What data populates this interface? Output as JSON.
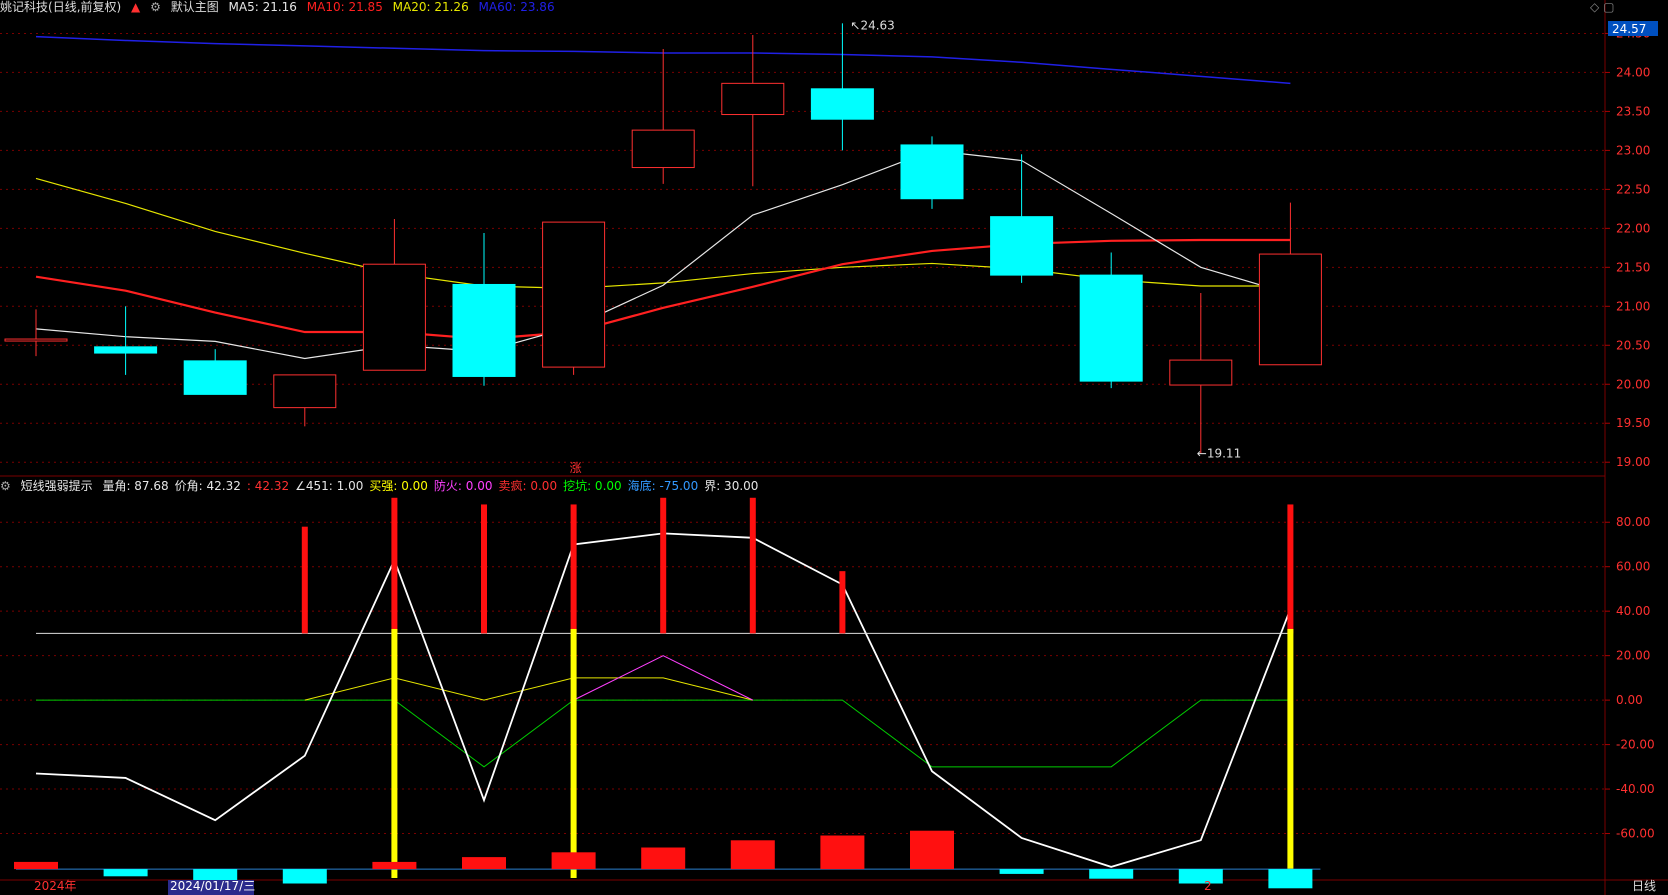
{
  "header": {
    "stock_name": "姚记科技",
    "mode": "(日线,前复权)",
    "template": "默认主图",
    "ma5": "MA5: 21.16",
    "ma10": "MA10: 21.85",
    "ma20": "MA20: 21.26",
    "ma60": "MA60: 23.86"
  },
  "price_axis": {
    "current_price_tag": "24.57",
    "ticks": [
      "24.50",
      "24.00",
      "23.50",
      "23.00",
      "22.50",
      "22.00",
      "21.50",
      "21.00",
      "20.50",
      "20.00",
      "19.50",
      "19.00"
    ]
  },
  "annotations": {
    "high_label": "24.63",
    "low_label": "19.11",
    "rise_marker": "涨"
  },
  "indicator": {
    "name": "短线强弱提示",
    "items": [
      {
        "text": "量角: 87.68",
        "color": "#e6e6e6"
      },
      {
        "text": "价角: 42.32",
        "color": "#e6e6e6"
      },
      {
        "text": ": 42.32",
        "color": "#ff3030"
      },
      {
        "text": "∠451: 1.00",
        "color": "#e6e6e6"
      },
      {
        "text": "买强: 0.00",
        "color": "#ffff00"
      },
      {
        "text": "防火: 0.00",
        "color": "#ff40ff"
      },
      {
        "text": "卖疯: 0.00",
        "color": "#ff3030"
      },
      {
        "text": "挖坑: 0.00",
        "color": "#00ff00"
      },
      {
        "text": "海底: -75.00",
        "color": "#3399ff"
      },
      {
        "text": "界: 30.00",
        "color": "#e6e6e6"
      }
    ],
    "ticks": [
      "80.00",
      "60.00",
      "40.00",
      "20.00",
      "0.00",
      "-20.00",
      "-40.00",
      "-60.00"
    ]
  },
  "footer": {
    "year_label": "2024年",
    "cursor_date": "2024/01/17/三",
    "month_label": "2",
    "period": "日线"
  },
  "colors": {
    "up": "#ff3030",
    "down": "#00ffff",
    "ma5": "#e6e6e6",
    "ma10": "#ff2020",
    "ma20": "#e6e600",
    "ma60": "#2020e6",
    "grid": "#7a0000"
  },
  "chart_data": {
    "type": "candlestick",
    "price_range": [
      18.9,
      24.57
    ],
    "candles": [
      {
        "open": 20.58,
        "close": 20.58,
        "high": 20.96,
        "low": 20.36
      },
      {
        "open": 20.48,
        "close": 20.4,
        "high": 21.0,
        "low": 20.12
      },
      {
        "open": 20.3,
        "close": 19.87,
        "high": 20.45,
        "low": 19.87
      },
      {
        "open": 19.7,
        "close": 20.12,
        "high": 20.12,
        "low": 19.46
      },
      {
        "open": 20.18,
        "close": 21.54,
        "high": 22.12,
        "low": 20.18
      },
      {
        "open": 21.28,
        "close": 20.1,
        "high": 21.94,
        "low": 19.98
      },
      {
        "open": 20.22,
        "close": 22.08,
        "high": 22.08,
        "low": 20.12
      },
      {
        "open": 22.78,
        "close": 23.26,
        "high": 24.3,
        "low": 22.57
      },
      {
        "open": 23.46,
        "close": 23.86,
        "high": 24.48,
        "low": 22.54
      },
      {
        "open": 23.79,
        "close": 23.4,
        "high": 24.63,
        "low": 23.0
      },
      {
        "open": 23.07,
        "close": 22.38,
        "high": 23.18,
        "low": 22.25
      },
      {
        "open": 22.15,
        "close": 21.4,
        "high": 22.95,
        "low": 21.3
      },
      {
        "open": 21.4,
        "close": 20.04,
        "high": 21.69,
        "low": 19.95
      },
      {
        "open": 19.99,
        "close": 20.31,
        "high": 21.17,
        "low": 19.11
      },
      {
        "open": 20.25,
        "close": 21.67,
        "high": 22.33,
        "low": 20.25
      }
    ],
    "ma5": [
      20.71,
      20.61,
      20.55,
      20.33,
      20.5,
      20.42,
      20.74,
      21.27,
      22.17,
      22.56,
      23.0,
      22.87,
      22.19,
      21.5,
      21.16
    ],
    "ma10": [
      21.38,
      21.2,
      20.92,
      20.67,
      20.67,
      20.58,
      20.67,
      20.98,
      21.25,
      21.54,
      21.71,
      21.8,
      21.84,
      21.85,
      21.85
    ],
    "ma20": [
      22.64,
      22.32,
      21.96,
      21.68,
      21.42,
      21.26,
      21.23,
      21.3,
      21.42,
      21.5,
      21.55,
      21.48,
      21.34,
      21.26,
      21.26
    ],
    "ma60": [
      24.46,
      24.41,
      24.37,
      24.34,
      24.31,
      24.28,
      24.27,
      24.25,
      24.25,
      24.23,
      24.2,
      24.13,
      24.04,
      23.95,
      23.86
    ],
    "indicator": {
      "range": [
        -80,
        90
      ],
      "white_line": [
        -33,
        -35,
        -54,
        -25,
        63,
        -45,
        70,
        75,
        73,
        52,
        -32,
        -62,
        -75,
        -63,
        41
      ],
      "yellow_line": [
        null,
        null,
        null,
        0,
        10,
        0,
        10,
        10,
        0,
        null,
        null,
        null,
        null,
        null,
        null
      ],
      "magenta_line": [
        null,
        null,
        null,
        null,
        null,
        null,
        0,
        20,
        0,
        null,
        null,
        null,
        null,
        null,
        null
      ],
      "green_line": [
        0,
        0,
        0,
        0,
        0,
        -30,
        0,
        0,
        0,
        0,
        -30,
        -30,
        -30,
        0,
        0
      ],
      "red_bars": [
        null,
        null,
        null,
        78,
        91,
        88,
        88,
        91,
        91,
        58,
        null,
        null,
        null,
        null,
        88
      ],
      "yellow_bars": [
        null,
        null,
        null,
        null,
        32,
        null,
        32,
        null,
        null,
        null,
        null,
        null,
        null,
        null,
        32
      ],
      "bottom_histogram": [
        3,
        -3,
        -5,
        -6,
        3,
        5,
        7,
        9,
        12,
        14,
        16,
        -2,
        -4,
        -6,
        -8
      ],
      "threshold": 30
    }
  }
}
